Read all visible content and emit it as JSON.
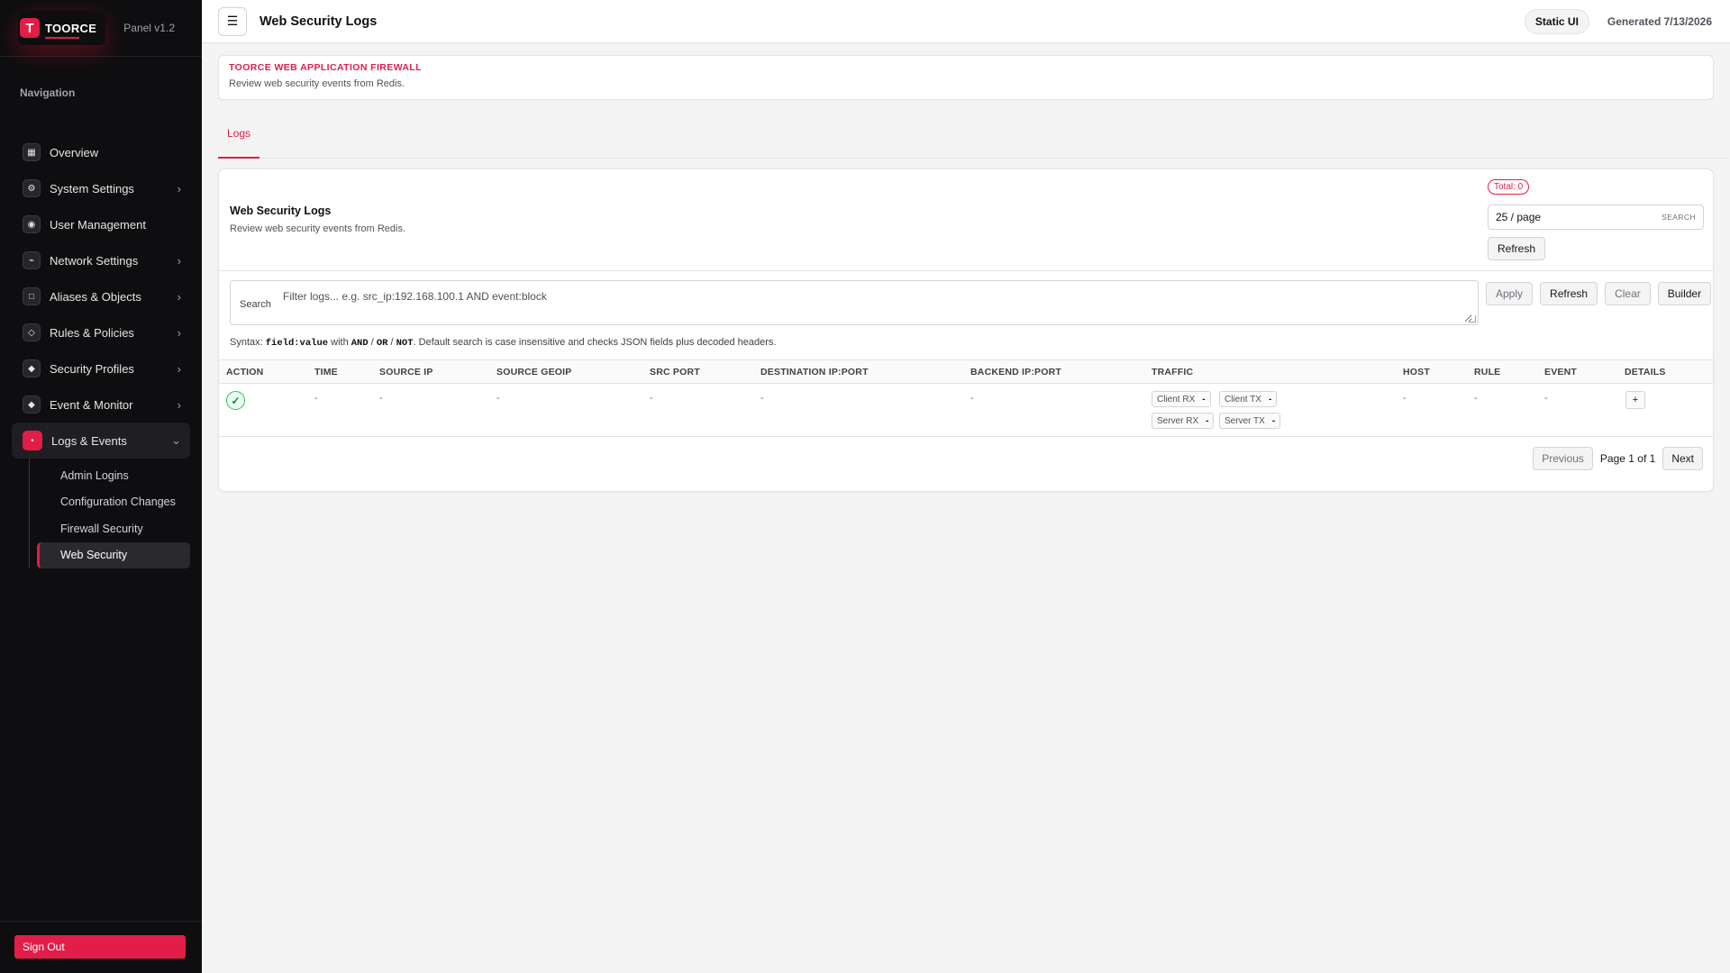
{
  "brand": {
    "name": "TOORCE",
    "mark": "T",
    "version": "Panel v1.2"
  },
  "sidebar": {
    "heading": "Navigation",
    "items": [
      {
        "label": "Overview",
        "icon": "▦",
        "chevron": ""
      },
      {
        "label": "System Settings",
        "icon": "⚙",
        "chevron": "›"
      },
      {
        "label": "User Management",
        "icon": "◉",
        "chevron": ""
      },
      {
        "label": "Network Settings",
        "icon": "⌁",
        "chevron": "›"
      },
      {
        "label": "Aliases & Objects",
        "icon": "□",
        "chevron": "›"
      },
      {
        "label": "Rules & Policies",
        "icon": "◇",
        "chevron": "›"
      },
      {
        "label": "Security Profiles",
        "icon": "◆",
        "chevron": "›"
      },
      {
        "label": "Event & Monitor",
        "icon": "◆",
        "chevron": "›"
      },
      {
        "label": "Logs & Events",
        "icon": "•",
        "chevron": "⌄"
      }
    ],
    "subitems": [
      "Admin Logins",
      "Configuration Changes",
      "Firewall Security",
      "Web Security"
    ],
    "signout": "Sign Out"
  },
  "topbar": {
    "menu_icon": "☰",
    "title": "Web Security Logs",
    "badge": "Static UI",
    "generated": "Generated 7/13/2026"
  },
  "banner": {
    "title": "TOORCE WEB APPLICATION FIREWALL",
    "subtitle": "Review web security events from Redis."
  },
  "tabs": [
    "Logs"
  ],
  "card": {
    "title": "Web Security Logs",
    "subtitle": "Review web security events from Redis.",
    "total": "Total: 0",
    "perpage": "25 / page",
    "perpage_hint": "SEARCH",
    "refresh": "Refresh"
  },
  "search": {
    "label": "Search",
    "placeholder": "Filter logs... e.g. src_ip:192.168.100.1 AND event:block",
    "value": "",
    "buttons": {
      "apply": "Apply",
      "refresh": "Refresh",
      "clear": "Clear",
      "builder": "Builder"
    },
    "syntax": {
      "prefix": "Syntax: ",
      "field": "field:value",
      "with": " with ",
      "and": "AND",
      "sep1": " / ",
      "or": "OR",
      "sep2": " / ",
      "not": "NOT",
      "rest": ". Default search is case insensitive and checks JSON fields plus decoded headers."
    }
  },
  "table": {
    "headers": [
      "ACTION",
      "TIME",
      "SOURCE IP",
      "SOURCE GEOIP",
      "SRC PORT",
      "DESTINATION IP:PORT",
      "BACKEND IP:PORT",
      "TRAFFIC",
      "HOST",
      "RULE",
      "EVENT",
      "DETAILS"
    ],
    "row": {
      "action_icon": "✓",
      "time": "-",
      "source_ip": "-",
      "source_geoip": "-",
      "src_port": "-",
      "destination": "-",
      "backend": "-",
      "traffic": [
        {
          "label": "Client RX",
          "value": "-"
        },
        {
          "label": "Client TX",
          "value": "-"
        },
        {
          "label": "Server RX",
          "value": "-"
        },
        {
          "label": "Server TX",
          "value": "-"
        }
      ],
      "host": "-",
      "rule": "-",
      "event": "-",
      "details": "+"
    }
  },
  "pager": {
    "previous": "Previous",
    "info": "Page 1 of 1",
    "next": "Next"
  },
  "colors": {
    "accent": "#e11d48",
    "sidebar_bg": "#0e0e10",
    "success": "#22c55e"
  }
}
